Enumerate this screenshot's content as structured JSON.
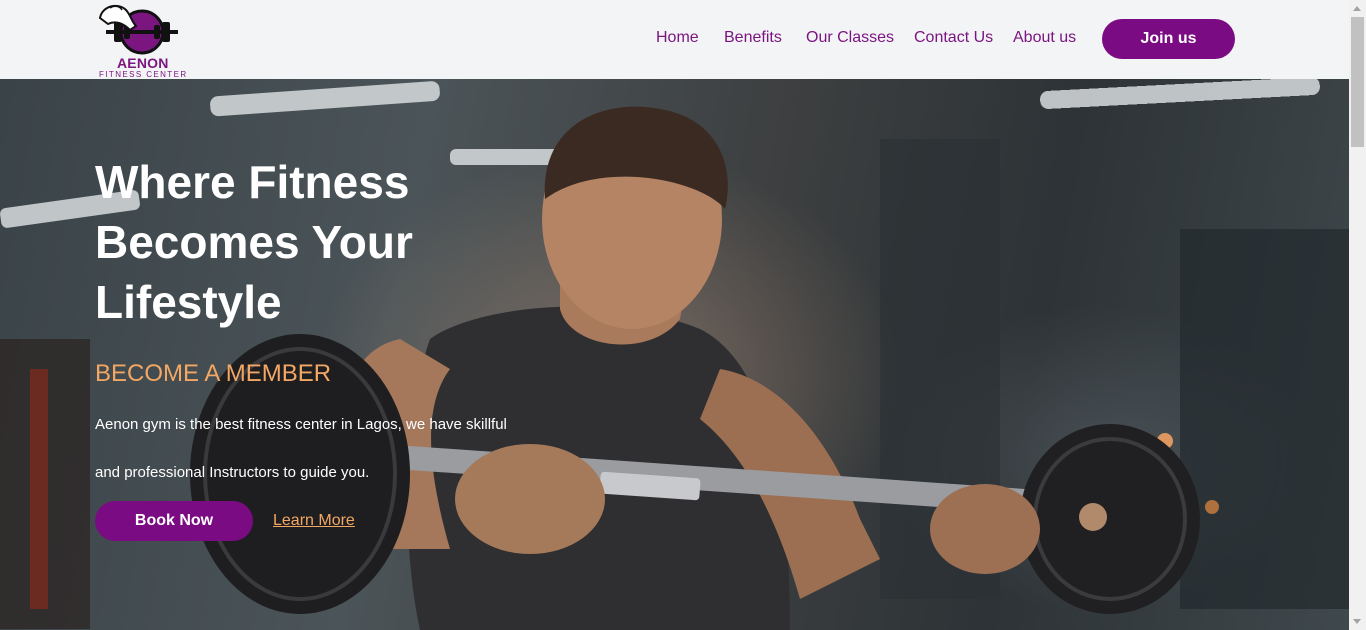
{
  "brand": {
    "name": "AENON",
    "tagline": "FITNESS CENTER",
    "primary_color": "#7b0b82",
    "accent_color": "#f2a764"
  },
  "nav": {
    "items": [
      {
        "label": "Home"
      },
      {
        "label": "Benefits"
      },
      {
        "label": "Our Classes"
      },
      {
        "label": "Contact Us"
      },
      {
        "label": "About us"
      }
    ],
    "cta_label": "Join us"
  },
  "hero": {
    "title": "Where Fitness Becomes Your Lifestyle",
    "subtitle": "BECOME A MEMBER",
    "description": "Aenon gym is the best fitness center in Lagos, we have skillful and professional Instructors to guide you.",
    "primary_button": "Book Now",
    "secondary_link": "Learn More",
    "image": "man-lifting-barbell-photo"
  }
}
